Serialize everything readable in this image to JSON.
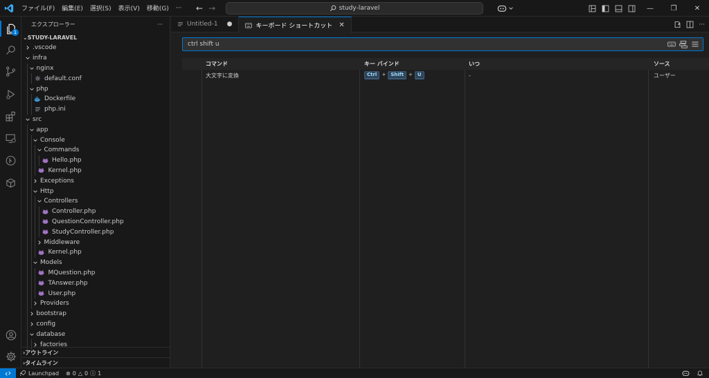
{
  "menu": [
    "ファイル(F)",
    "編集(E)",
    "選択(S)",
    "表示(V)",
    "移動(G)",
    "···"
  ],
  "command_center": {
    "label": "study-laravel"
  },
  "sidebar": {
    "header": "エクスプローラー",
    "more": "···",
    "root": "STUDY-LARAVEL",
    "tree": [
      {
        "label": ".vscode",
        "depth": 1,
        "kind": "folder",
        "open": false
      },
      {
        "label": "infra",
        "depth": 1,
        "kind": "folder",
        "open": true
      },
      {
        "label": "nginx",
        "depth": 2,
        "kind": "folder",
        "open": true
      },
      {
        "label": "default.conf",
        "depth": 3,
        "kind": "gear"
      },
      {
        "label": "php",
        "depth": 2,
        "kind": "folder",
        "open": true
      },
      {
        "label": "Dockerfile",
        "depth": 3,
        "kind": "docker"
      },
      {
        "label": "php.ini",
        "depth": 3,
        "kind": "lines"
      },
      {
        "label": "src",
        "depth": 1,
        "kind": "folder",
        "open": true
      },
      {
        "label": "app",
        "depth": 2,
        "kind": "folder",
        "open": true
      },
      {
        "label": "Console",
        "depth": 3,
        "kind": "folder",
        "open": true
      },
      {
        "label": "Commands",
        "depth": 4,
        "kind": "folder",
        "open": true
      },
      {
        "label": "Hello.php",
        "depth": 5,
        "kind": "php"
      },
      {
        "label": "Kernel.php",
        "depth": 4,
        "kind": "php"
      },
      {
        "label": "Exceptions",
        "depth": 3,
        "kind": "folder",
        "open": false
      },
      {
        "label": "Http",
        "depth": 3,
        "kind": "folder",
        "open": true
      },
      {
        "label": "Controllers",
        "depth": 4,
        "kind": "folder",
        "open": true
      },
      {
        "label": "Controller.php",
        "depth": 5,
        "kind": "php"
      },
      {
        "label": "QuestionController.php",
        "depth": 5,
        "kind": "php"
      },
      {
        "label": "StudyController.php",
        "depth": 5,
        "kind": "php"
      },
      {
        "label": "Middleware",
        "depth": 4,
        "kind": "folder",
        "open": false
      },
      {
        "label": "Kernel.php",
        "depth": 4,
        "kind": "php"
      },
      {
        "label": "Models",
        "depth": 3,
        "kind": "folder",
        "open": true
      },
      {
        "label": "MQuestion.php",
        "depth": 4,
        "kind": "php"
      },
      {
        "label": "TAnswer.php",
        "depth": 4,
        "kind": "php"
      },
      {
        "label": "User.php",
        "depth": 4,
        "kind": "php"
      },
      {
        "label": "Providers",
        "depth": 3,
        "kind": "folder",
        "open": false
      },
      {
        "label": "bootstrap",
        "depth": 2,
        "kind": "folder",
        "open": false
      },
      {
        "label": "config",
        "depth": 2,
        "kind": "folder",
        "open": false
      },
      {
        "label": "database",
        "depth": 2,
        "kind": "folder",
        "open": true
      },
      {
        "label": "factories",
        "depth": 3,
        "kind": "folder",
        "open": false
      }
    ],
    "outline": "アウトライン",
    "timeline": "タイムライン"
  },
  "tabs": [
    {
      "label": "Untitled-1",
      "active": false,
      "dirty": true
    },
    {
      "label": "キーボード ショートカット",
      "active": true
    }
  ],
  "keybindings": {
    "search_value": "ctrl shift u",
    "columns": {
      "command": "コマンド",
      "keybinding": "キー バインド",
      "when": "いつ",
      "source": "ソース"
    },
    "rows": [
      {
        "command": "大文字に変換",
        "keys": [
          "Ctrl",
          "Shift",
          "U"
        ],
        "key_sep": "+",
        "when": "-",
        "source": "ユーザー"
      }
    ]
  },
  "statusbar": {
    "launchpad": "Launchpad",
    "errors": "0",
    "warnings": "0",
    "info": "1"
  },
  "colors": {
    "accent": "#0078d4",
    "key_bg": "#2f4358",
    "key_fg": "#9cdcfe"
  }
}
